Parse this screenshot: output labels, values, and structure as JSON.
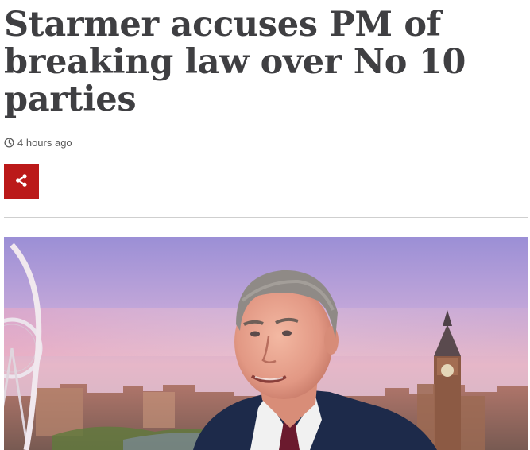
{
  "article": {
    "headline": "Starmer accuses PM of breaking law over No 10 parties",
    "timestamp": "4 hours ago",
    "icons": {
      "timestamp": "clock-icon",
      "share": "share-icon"
    },
    "colors": {
      "share_button": "#bb1919",
      "headline_text": "#3f3f42"
    }
  }
}
